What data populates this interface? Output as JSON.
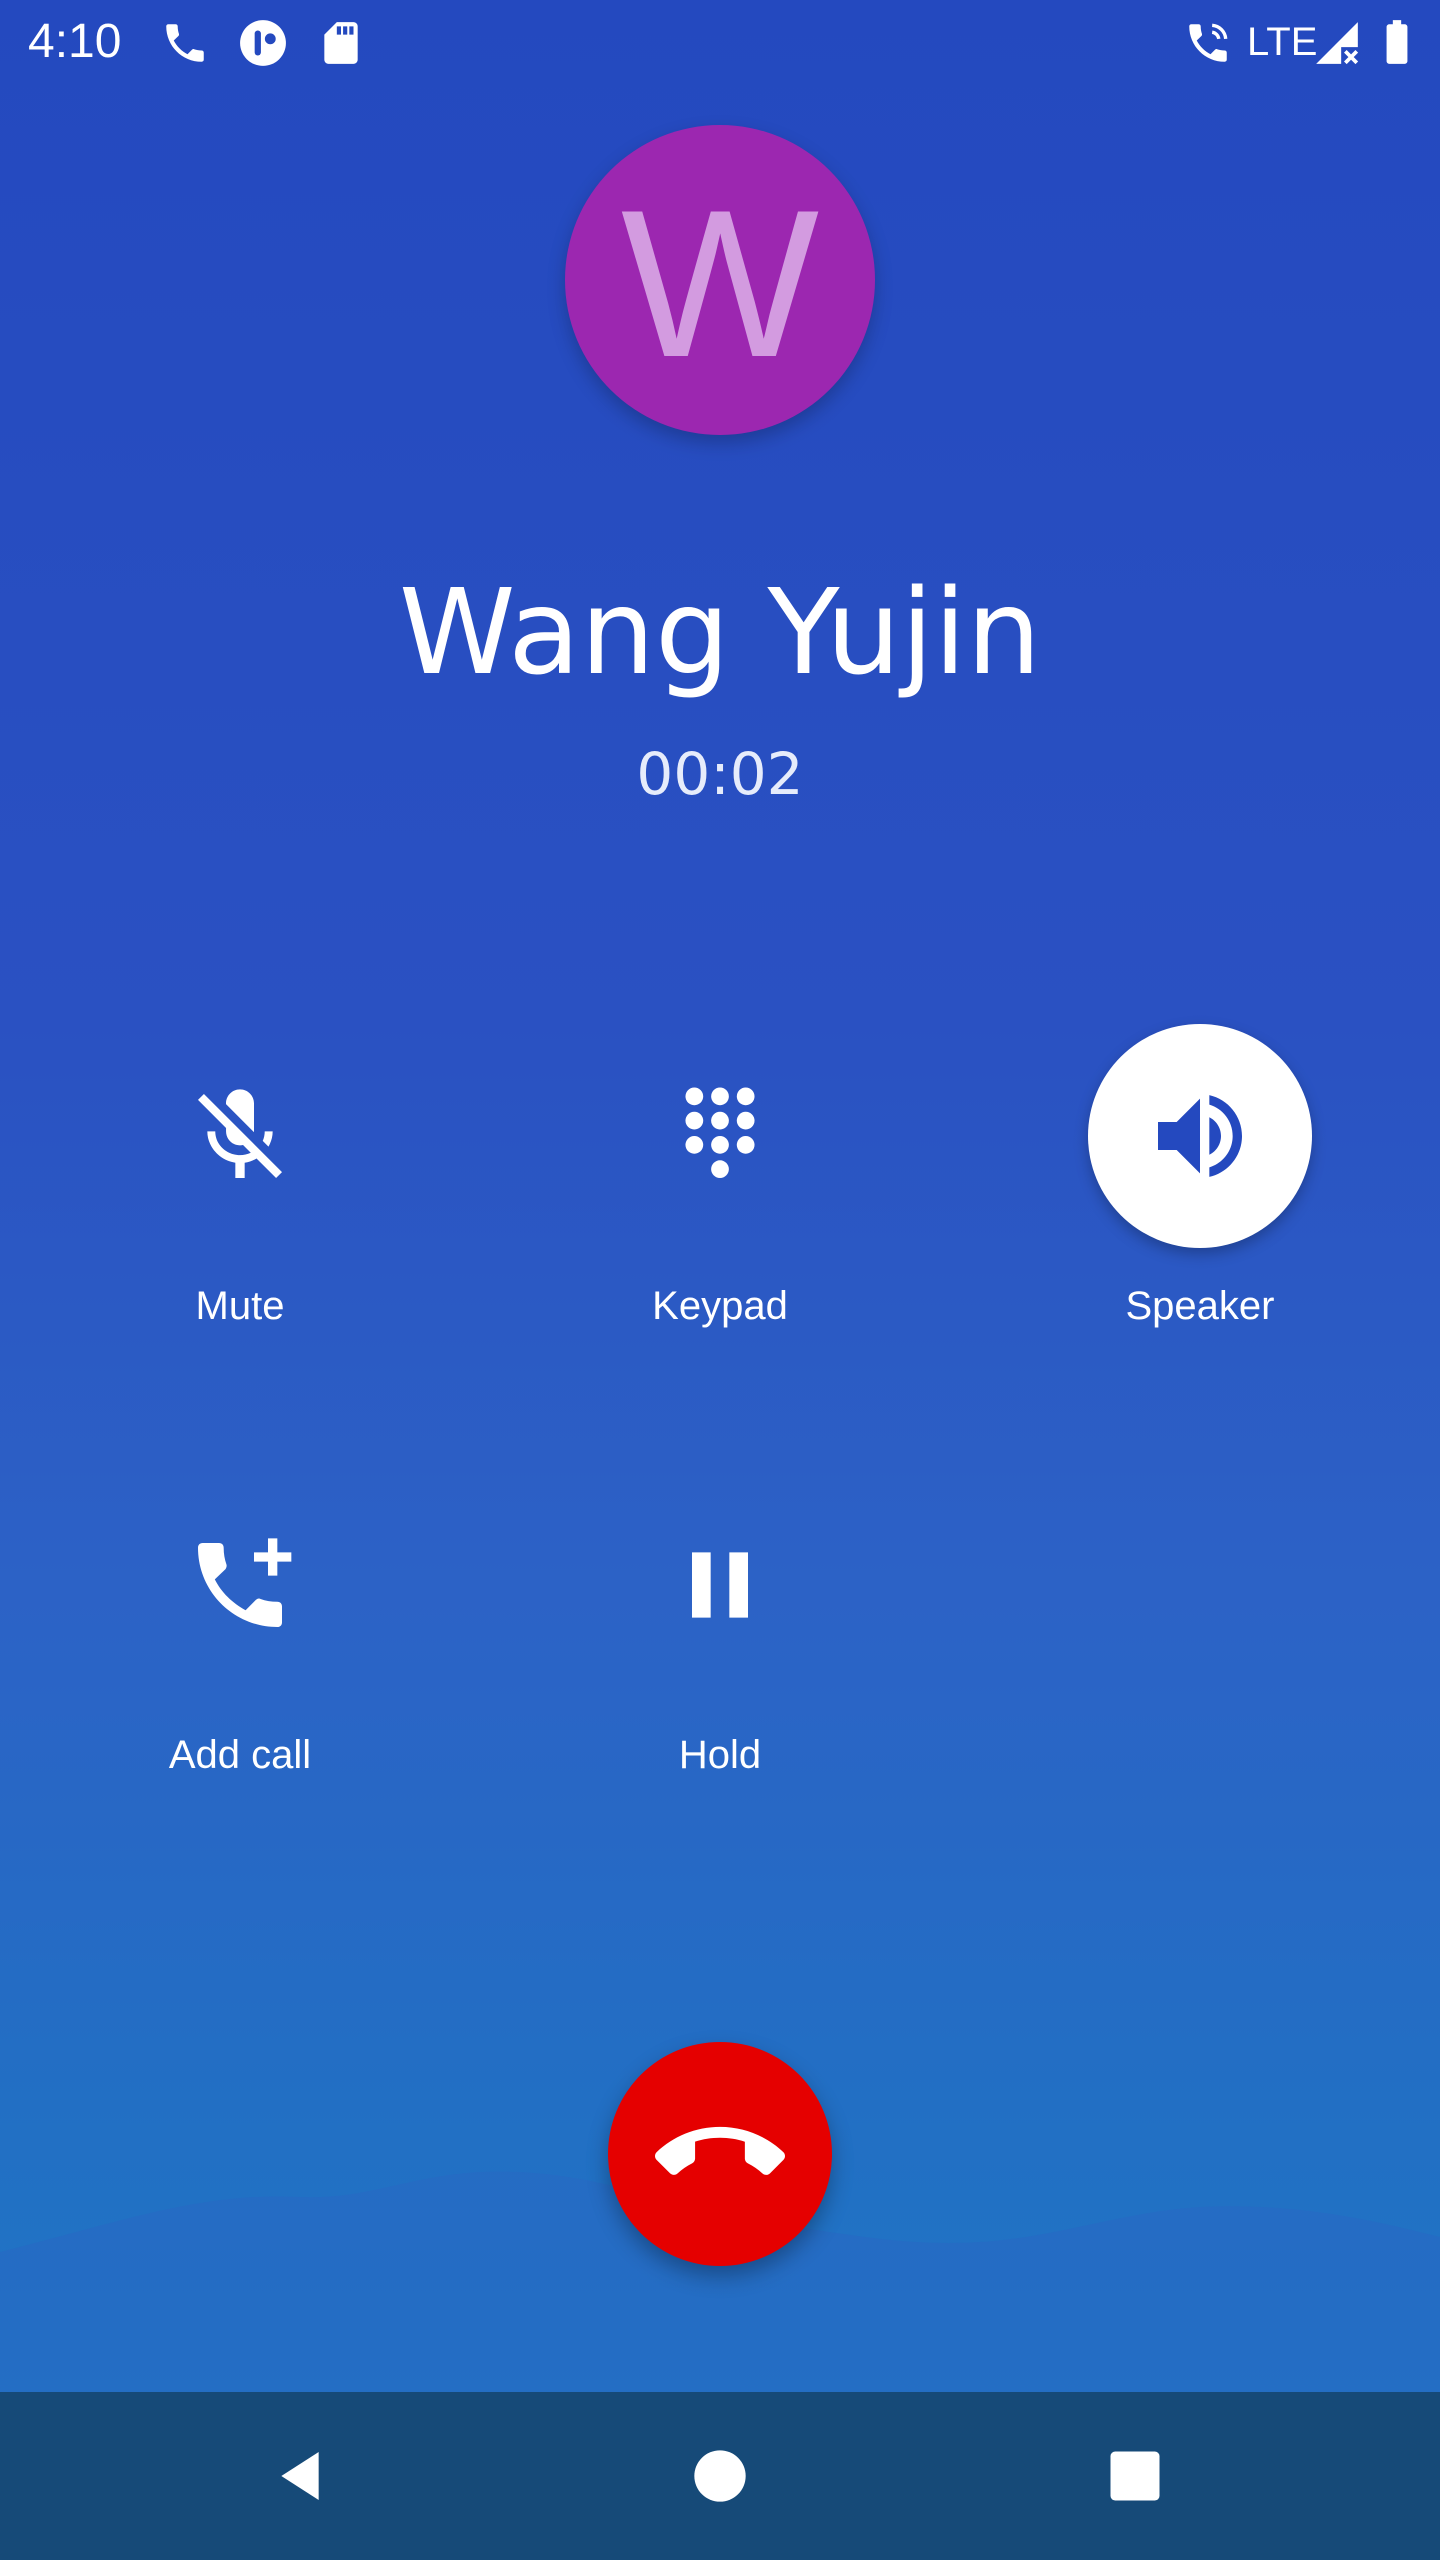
{
  "status_bar": {
    "time": "4:10",
    "network": "LTE",
    "icons": [
      "phone-icon",
      "app-badge-icon",
      "sd-card-icon",
      "wifi-calling-icon",
      "signal-no-data-icon",
      "battery-icon"
    ]
  },
  "caller": {
    "initial": "W",
    "name": "Wang Yujin",
    "duration": "00:02",
    "avatar_color": "#9c27b0"
  },
  "controls": {
    "mute": {
      "label": "Mute",
      "icon": "mic-off-icon",
      "active": false
    },
    "keypad": {
      "label": "Keypad",
      "icon": "dialpad-icon",
      "active": false
    },
    "speaker": {
      "label": "Speaker",
      "icon": "volume-icon",
      "active": true
    },
    "add_call": {
      "label": "Add call",
      "icon": "add-call-icon",
      "active": false
    },
    "hold": {
      "label": "Hold",
      "icon": "pause-icon",
      "active": false
    }
  },
  "end_call": {
    "icon": "call-end-icon",
    "color": "#e50000"
  },
  "nav": {
    "back": "back-icon",
    "home": "home-icon",
    "recents": "recents-icon"
  },
  "colors": {
    "background_top": "#2449bf",
    "background_bottom": "#1e78c6",
    "nav_bar": "#164a78",
    "accent": "#ffffff"
  }
}
